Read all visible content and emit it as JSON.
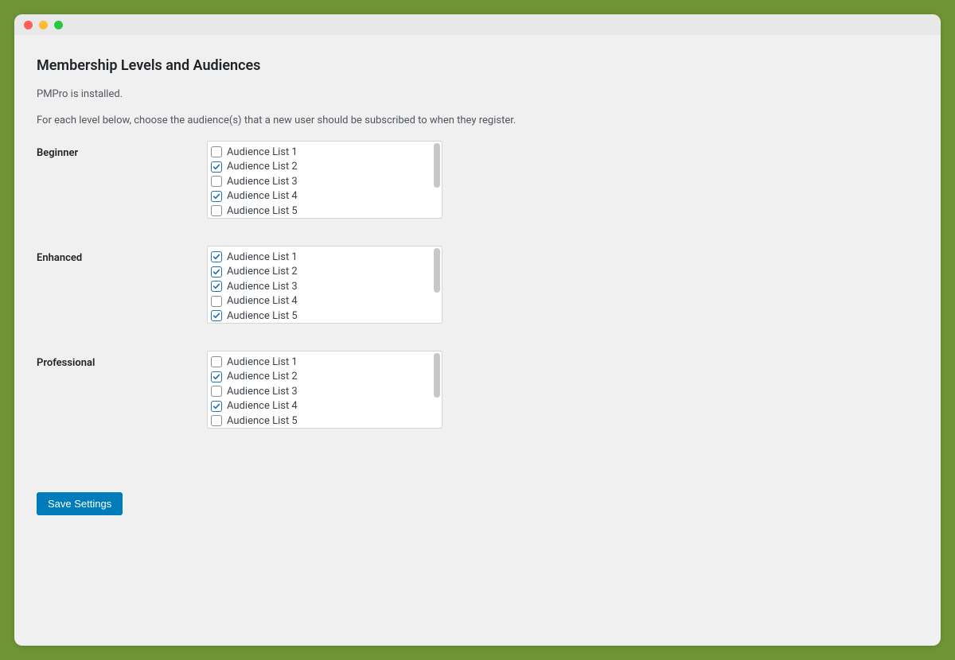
{
  "page": {
    "title": "Membership Levels and Audiences",
    "status": "PMPro is installed.",
    "description": "For each level below, choose the audience(s) that a new user should be subscribed to when they register."
  },
  "levels": [
    {
      "name": "Beginner",
      "options": [
        {
          "label": "Audience List 1",
          "checked": false
        },
        {
          "label": "Audience List 2",
          "checked": true
        },
        {
          "label": "Audience List 3",
          "checked": false
        },
        {
          "label": "Audience List 4",
          "checked": true
        },
        {
          "label": "Audience List 5",
          "checked": false
        }
      ]
    },
    {
      "name": "Enhanced",
      "options": [
        {
          "label": "Audience List 1",
          "checked": true
        },
        {
          "label": "Audience List 2",
          "checked": true
        },
        {
          "label": "Audience List 3",
          "checked": true
        },
        {
          "label": "Audience List 4",
          "checked": false
        },
        {
          "label": "Audience List 5",
          "checked": true
        }
      ]
    },
    {
      "name": "Professional",
      "options": [
        {
          "label": "Audience List 1",
          "checked": false
        },
        {
          "label": "Audience List 2",
          "checked": true
        },
        {
          "label": "Audience List 3",
          "checked": false
        },
        {
          "label": "Audience List 4",
          "checked": true
        },
        {
          "label": "Audience List 5",
          "checked": false
        }
      ]
    }
  ],
  "actions": {
    "save_label": "Save Settings"
  },
  "colors": {
    "accent": "#007cba",
    "page_bg": "#6e9437"
  }
}
